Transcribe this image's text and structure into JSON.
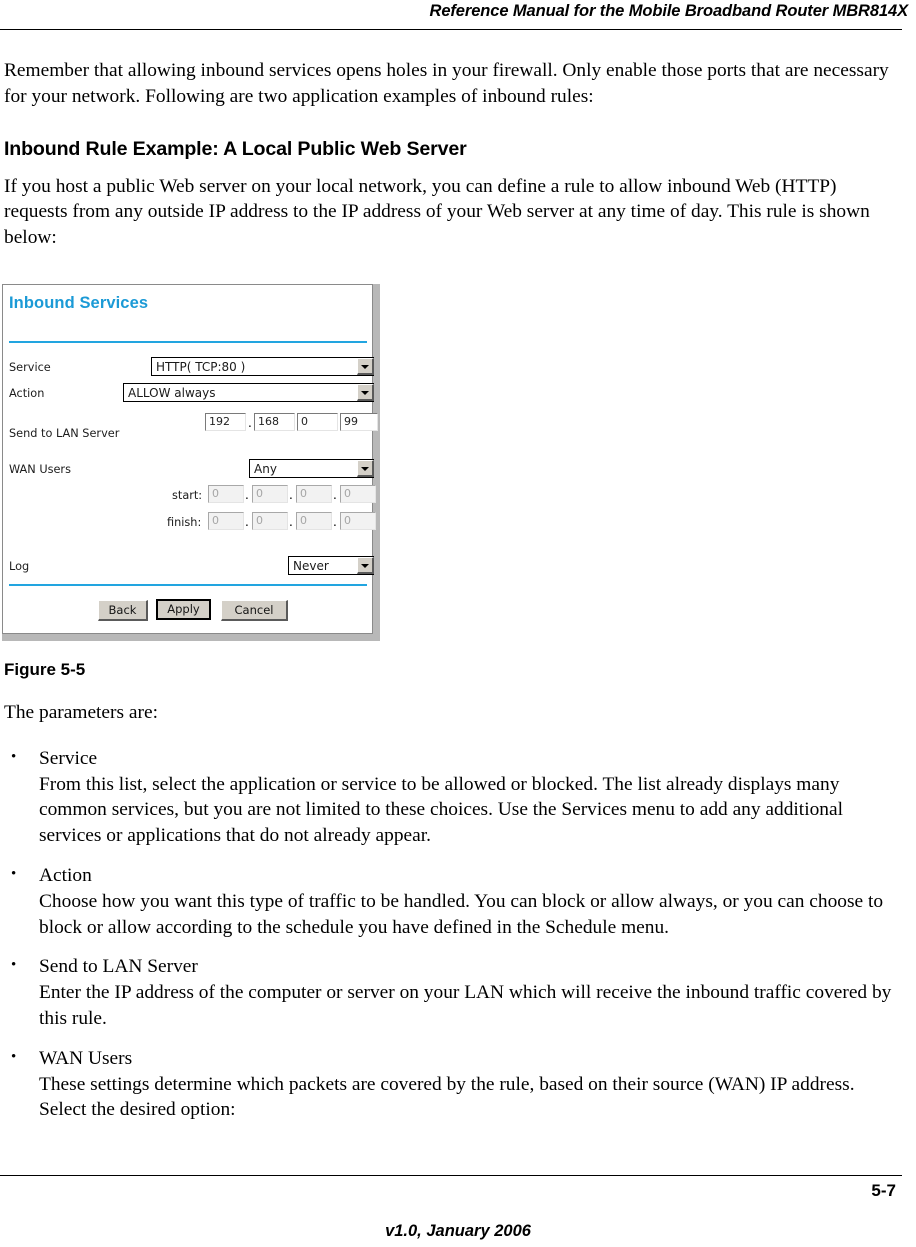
{
  "header": {
    "running_title": "Reference Manual for the Mobile Broadband Router MBR814X"
  },
  "intro": {
    "paragraph": "Remember that allowing inbound services opens holes in your firewall. Only enable those ports that are necessary for your network. Following are two application examples of inbound rules:"
  },
  "section": {
    "heading": "Inbound Rule Example: A Local Public Web Server",
    "paragraph": "If you host a public Web server on your local network, you can define a rule to allow inbound Web (HTTP) requests from any outside IP address to the IP address of your Web server at any time of day. This rule is shown below:"
  },
  "figure": {
    "caption": "Figure 5-5",
    "screenshot": {
      "title": "Inbound Services",
      "fields": {
        "service": {
          "label": "Service",
          "value": "HTTP( TCP:80 )"
        },
        "action": {
          "label": "Action",
          "value": "ALLOW always"
        },
        "send_to_lan_server": {
          "label": "Send to LAN Server",
          "octets": [
            "192",
            "168",
            "0",
            "99"
          ],
          "separator": "."
        },
        "wan_users": {
          "label": "WAN Users",
          "value": "Any",
          "start_label": "start:",
          "start_octets": [
            "0",
            "0",
            "0",
            "0"
          ],
          "finish_label": "finish:",
          "finish_octets": [
            "0",
            "0",
            "0",
            "0"
          ]
        },
        "log": {
          "label": "Log",
          "value": "Never"
        }
      },
      "buttons": {
        "back": "Back",
        "apply": "Apply",
        "cancel": "Cancel"
      }
    }
  },
  "parameters": {
    "intro": "The parameters are:",
    "items": [
      {
        "term": "Service",
        "description": "From this list, select the application or service to be allowed or blocked. The list already displays many common services, but you are not limited to these choices. Use the Services menu to add any additional services or applications that do not already appear."
      },
      {
        "term": "Action",
        "description": "Choose how you want this type of traffic to be handled. You can block or allow always, or you can choose to block or allow according to the schedule you have defined in the Schedule menu."
      },
      {
        "term": "Send to LAN Server",
        "description": "Enter the IP address of the computer or server on your LAN which will receive the inbound traffic covered by this rule."
      },
      {
        "term": "WAN Users",
        "description": "These settings determine which packets are covered by the rule, based on their source (WAN) IP address. Select the desired option:"
      }
    ]
  },
  "footer": {
    "page_number": "5-7",
    "version": "v1.0, January 2006"
  },
  "colors": {
    "accent_blue": "#22a5e0",
    "title_blue": "#1b9ad6",
    "button_face": "#d4d0c8"
  }
}
